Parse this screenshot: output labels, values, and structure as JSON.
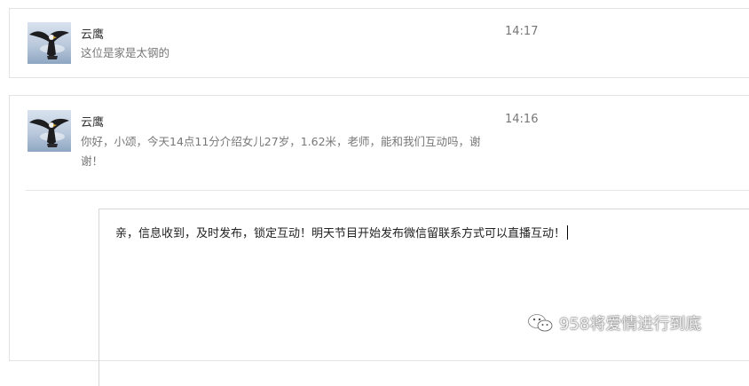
{
  "messages": [
    {
      "sender": "云鹰",
      "time": "14:17",
      "text": "这位是家是太钢的",
      "avatar_icon": "eagle-avatar-icon"
    },
    {
      "sender": "云鹰",
      "time": "14:16",
      "text": "你好，小颂，今天14点11分介绍女儿27岁，1.62米，老师，能和我们互动吗，谢谢！",
      "avatar_icon": "eagle-avatar-icon"
    }
  ],
  "reply": {
    "text": "亲，信息收到，及时发布，锁定互动！明天节目开始发布微信留联系方式可以直播互动！"
  },
  "watermark": {
    "text": "958将爱情进行到底",
    "icon": "wechat-icon"
  },
  "colors": {
    "border": "#e3e3e3",
    "muted_text": "#777777",
    "name_text": "#333333"
  }
}
